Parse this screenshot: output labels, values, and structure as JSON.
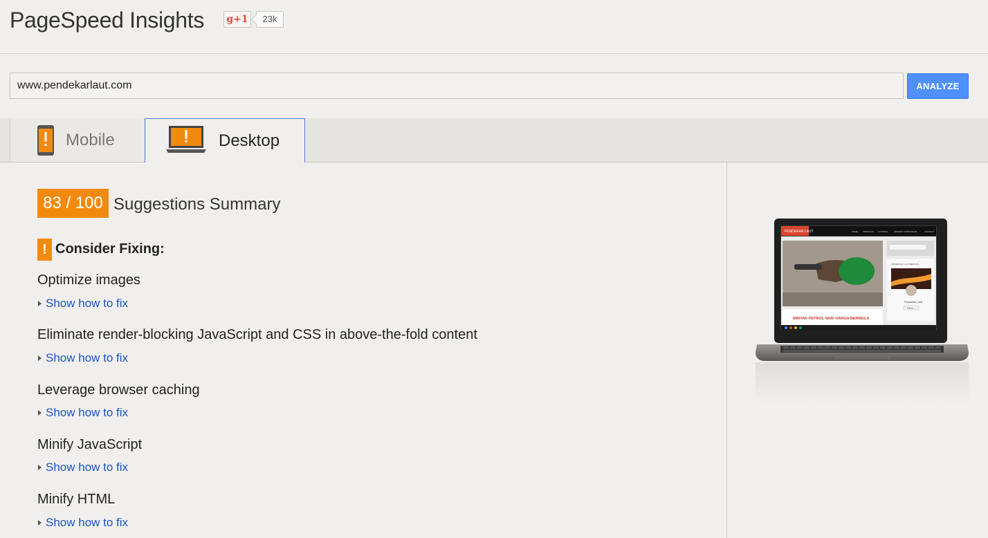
{
  "header": {
    "title": "PageSpeed Insights",
    "gplus_label": "g+1",
    "gplus_count": "23k"
  },
  "url_bar": {
    "value": "www.pendekarlaut.com",
    "analyze_label": "ANALYZE"
  },
  "tabs": [
    {
      "label": "Mobile",
      "icon": "phone-warning-icon",
      "active": false
    },
    {
      "label": "Desktop",
      "icon": "laptop-warning-icon",
      "active": true
    }
  ],
  "summary": {
    "score": "83 / 100",
    "title": "Suggestions Summary",
    "score_color": "#f28a0e"
  },
  "consider": {
    "icon": "!",
    "label": "Consider Fixing:"
  },
  "rules": [
    {
      "title": "Optimize images",
      "link": "Show how to fix"
    },
    {
      "title": "Eliminate render-blocking JavaScript and CSS in above-the-fold content",
      "link": "Show how to fix"
    },
    {
      "title": "Leverage browser caching",
      "link": "Show how to fix"
    },
    {
      "title": "Minify JavaScript",
      "link": "Show how to fix"
    },
    {
      "title": "Minify HTML",
      "link": "Show how to fix"
    }
  ],
  "preview": {
    "site_logo": "PENDEKAR LAUT",
    "nav": [
      "HOME",
      "PERSANAT",
      "TUTORIAL",
      "SENARAI KANDUNGAN",
      "CONTACT"
    ],
    "headline": "MINYAK PETROL NAIK HARGA BERMULA",
    "sidebar_heading": "~ PENDEKAR LAUT BERANDI ~",
    "sidebar_name": "Pendekar Laut",
    "follow_label": "Follow"
  },
  "colors": {
    "accent_blue": "#4d90fe",
    "warning_orange": "#f28a0e",
    "link_blue": "#1a53c6"
  }
}
